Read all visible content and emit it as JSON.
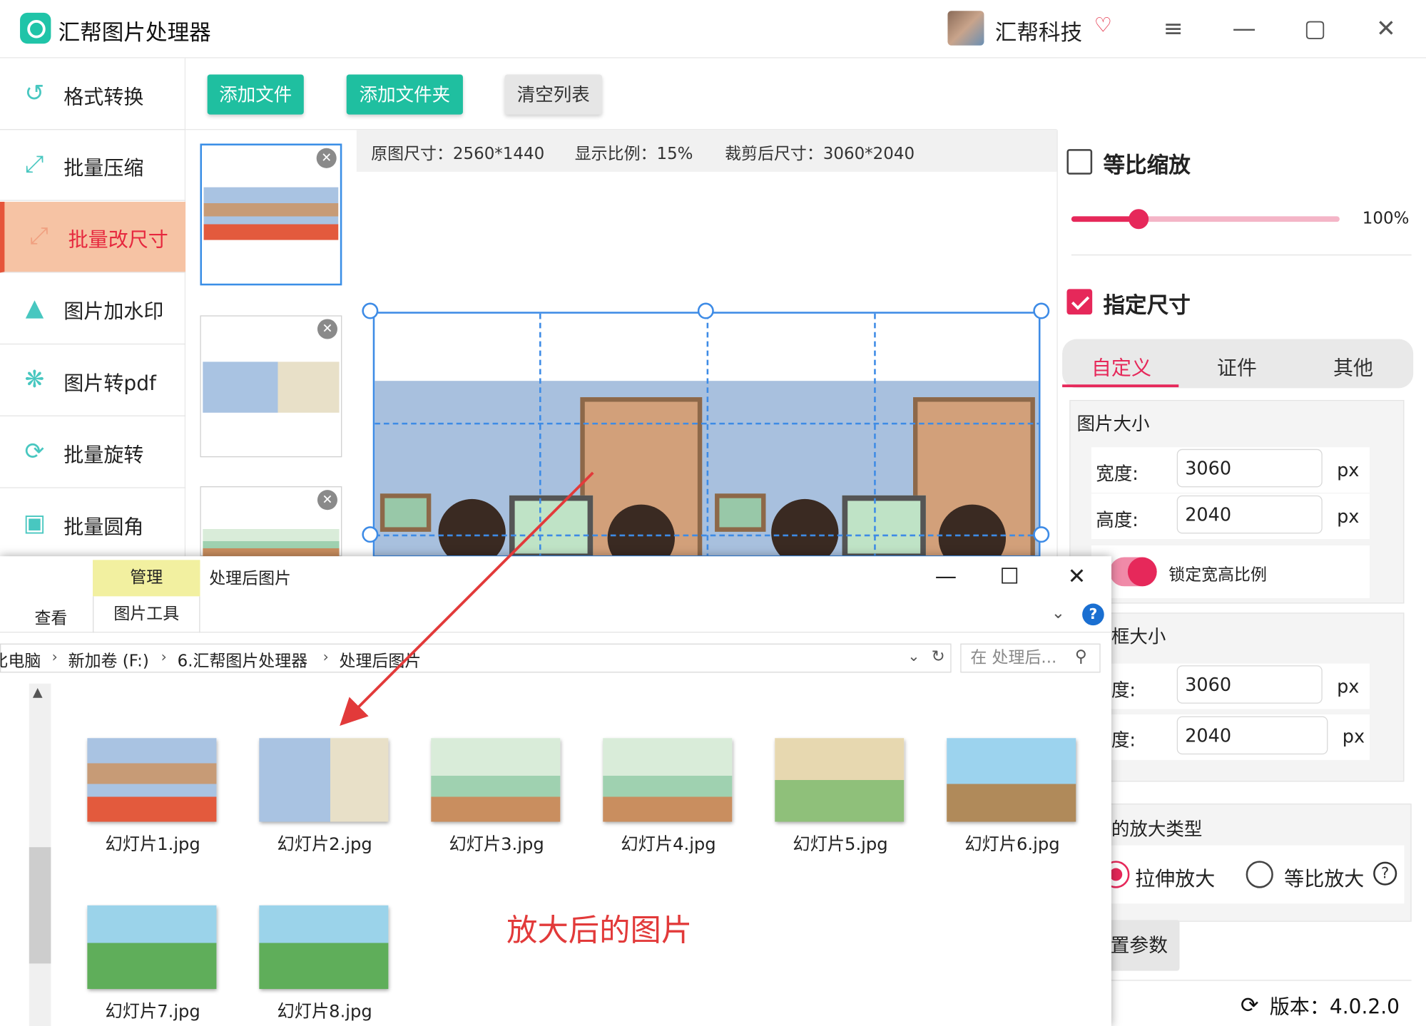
{
  "app": {
    "title": "汇帮图片处理器",
    "company": "汇帮科技",
    "accent_color": "#e6285a",
    "brand_color": "#1fbfa0",
    "icons": [
      "app-logo-icon",
      "vip-heart-icon",
      "menu-icon",
      "minimize-icon",
      "maximize-icon",
      "close-icon"
    ]
  },
  "sidebar": {
    "items": [
      {
        "label": "格式转换",
        "icon": "convert-icon"
      },
      {
        "label": "批量压缩",
        "icon": "compress-icon"
      },
      {
        "label": "批量改尺寸",
        "icon": "resize-icon",
        "active": true
      },
      {
        "label": "图片加水印",
        "icon": "watermark-icon"
      },
      {
        "label": "图片转pdf",
        "icon": "pdf-icon"
      },
      {
        "label": "批量旋转",
        "icon": "rotate-icon"
      },
      {
        "label": "批量圆角",
        "icon": "rounded-corner-icon"
      }
    ]
  },
  "toolbar": {
    "add_file": "添加文件",
    "add_folder": "添加文件夹",
    "clear_list": "清空列表"
  },
  "info": {
    "original_size": "原图尺寸：2560*1440",
    "display_ratio": "显示比例：15%",
    "cropped_size": "裁剪后尺寸：3060*2040"
  },
  "panel": {
    "proportional_scale": {
      "label": "等比缩放",
      "checked": false
    },
    "scale_value": "100%",
    "scale_fraction": 0.25,
    "specify_size": {
      "label": "指定尺寸",
      "checked": true
    },
    "tabs": [
      "自定义",
      "证件",
      "其他"
    ],
    "active_tab": "自定义",
    "image_size": {
      "title": "图片大小",
      "width_label": "宽度:",
      "width_value": "3060",
      "height_label": "高度:",
      "height_value": "2040",
      "unit": "px",
      "lock_ratio": "锁定宽高比例"
    },
    "frame_size": {
      "title": "边框大小",
      "title_visible": "框大小",
      "width_label_visible": "度:",
      "width_value": "3060",
      "height_label_visible": "度:",
      "height_value": "2040",
      "unit": "px"
    },
    "zoom_type": {
      "title_visible": "的放大类型",
      "options": [
        "拉伸放大",
        "等比放大"
      ],
      "selected": "拉伸放大"
    },
    "reset_visible": "置参数",
    "version": "版本：4.0.2.0"
  },
  "explorer": {
    "tab_manage": "管理",
    "title": "处理后图片",
    "tab_view": "查看",
    "tab_picture_tools": "图片工具",
    "breadcrumb": [
      "比电脑",
      "新加卷 (F:)",
      "6.汇帮图片处理器",
      "处理后图片"
    ],
    "search_placeholder": "在 处理后...",
    "help": "?",
    "files": [
      {
        "name": "幻灯片1.jpg",
        "scene": "classroom"
      },
      {
        "name": "幻灯片2.jpg",
        "scene": "classroom2"
      },
      {
        "name": "幻灯片3.jpg",
        "scene": "green"
      },
      {
        "name": "幻灯片4.jpg",
        "scene": "green"
      },
      {
        "name": "幻灯片5.jpg",
        "scene": "park"
      },
      {
        "name": "幻灯片6.jpg",
        "scene": "zoo"
      },
      {
        "name": "幻灯片7.jpg",
        "scene": "garden"
      },
      {
        "name": "幻灯片8.jpg",
        "scene": "garden"
      }
    ]
  },
  "annotation": {
    "text": "放大后的图片",
    "color": "#e23a3a"
  }
}
